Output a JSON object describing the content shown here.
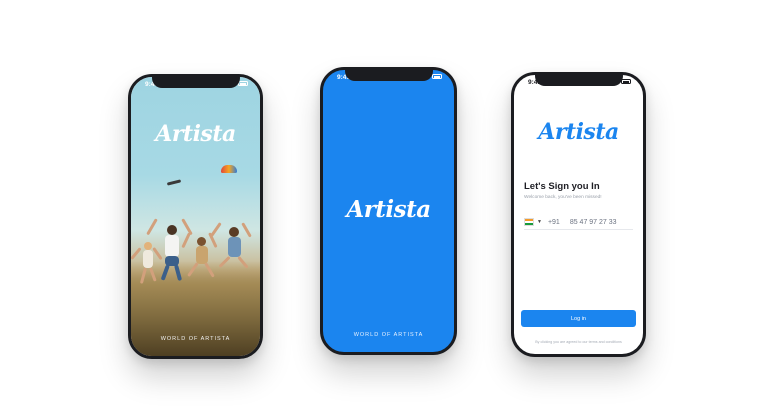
{
  "phone1": {
    "time": "9:41",
    "logo": "Artista",
    "tagline": "WORLD OF ARTISTA"
  },
  "phone2": {
    "time": "9:41",
    "logo": "Artista",
    "tagline": "WORLD OF ARTISTA"
  },
  "phone3": {
    "time": "9:41",
    "logo": "Artista",
    "title": "Let's Sign you In",
    "subtitle": "Welcome back, you've been missed!",
    "country_code": "+91",
    "phone_number": "85 47 97 27 33",
    "login_label": "Log in",
    "terms": "By clicking you are agreed to our terms and conditions"
  },
  "colors": {
    "brand_blue": "#1b85ef",
    "device_frame": "#1b1c20"
  }
}
